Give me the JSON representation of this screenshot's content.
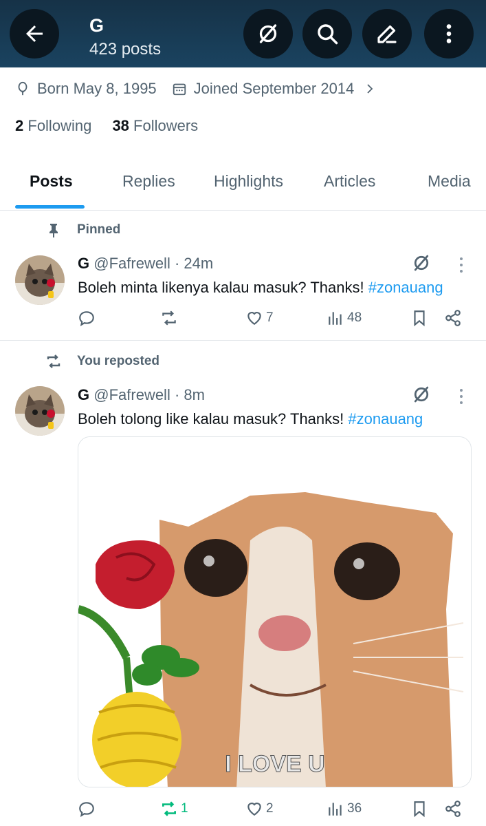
{
  "header": {
    "name": "G",
    "post_count": "423 posts",
    "icons": [
      "back-arrow-icon",
      "grok-icon",
      "search-icon",
      "compose-icon",
      "more-vertical-icon"
    ]
  },
  "profile": {
    "born": "Born May 8, 1995",
    "joined": "Joined September 2014",
    "following_count": "2",
    "following_label": "Following",
    "followers_count": "38",
    "followers_label": "Followers"
  },
  "tabs": [
    {
      "label": "Posts",
      "active": true
    },
    {
      "label": "Replies",
      "active": false
    },
    {
      "label": "Highlights",
      "active": false
    },
    {
      "label": "Articles",
      "active": false
    },
    {
      "label": "Media",
      "active": false
    }
  ],
  "posts": [
    {
      "context": "Pinned",
      "name": "G",
      "handle": "@Fafrewell",
      "time": "24m",
      "text": "Boleh minta likenya kalau masuk? Thanks! ",
      "hashtag": "#zonauang",
      "replies": "",
      "reposts": "",
      "likes": "7",
      "views": "48"
    },
    {
      "context": "You reposted",
      "name": "G",
      "handle": "@Fafrewell",
      "time": "8m",
      "text": "Boleh tolong like kalau masuk? Thanks! ",
      "hashtag": "#zonauang",
      "media_caption": "I LOVE U",
      "replies": "",
      "reposts": "1",
      "likes": "2",
      "views": "36"
    }
  ],
  "colors": {
    "header_bg": "#163247",
    "accent": "#1d9bf0",
    "repost_active": "#00ba7c",
    "muted": "#536471"
  }
}
